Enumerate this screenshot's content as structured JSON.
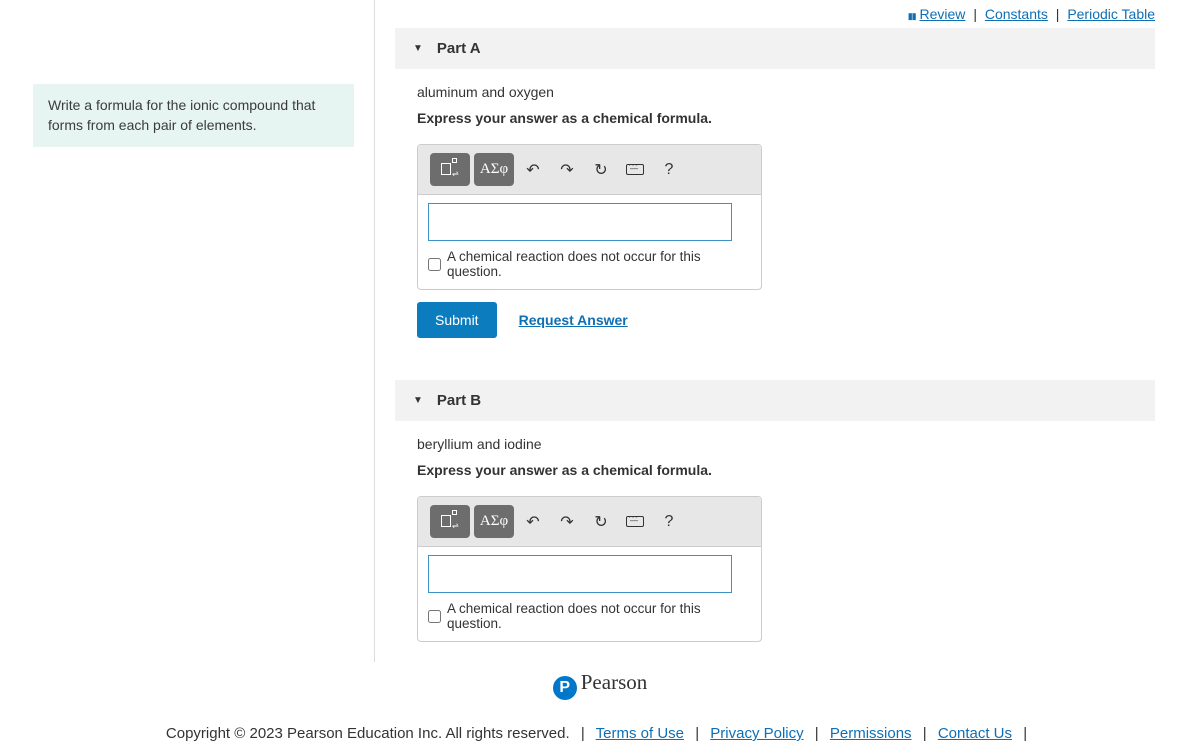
{
  "topLinks": {
    "review": "Review",
    "constants": "Constants",
    "periodic": "Periodic Table"
  },
  "prompt": "Write a formula for the ionic compound that forms from each pair of elements.",
  "partA": {
    "title": "Part A",
    "question": "aluminum and oxygen",
    "instruction": "Express your answer as a chemical formula.",
    "checkbox": "A chemical reaction does not occur for this question.",
    "submit": "Submit",
    "request": "Request Answer"
  },
  "partB": {
    "title": "Part B",
    "question": "beryllium and iodine",
    "instruction": "Express your answer as a chemical formula.",
    "checkbox": "A chemical reaction does not occur for this question."
  },
  "toolbar": {
    "greek": "ΑΣφ",
    "help": "?"
  },
  "brand": "Pearson",
  "footer": {
    "copyright": "Copyright © 2023 Pearson Education Inc. All rights reserved.",
    "terms": "Terms of Use",
    "privacy": "Privacy Policy",
    "permissions": "Permissions",
    "contact": "Contact Us"
  }
}
